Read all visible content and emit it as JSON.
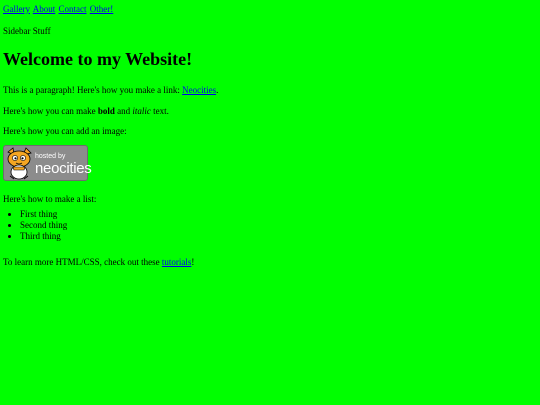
{
  "nav": {
    "links": [
      "Gallery",
      "About",
      "Contact",
      "Other!"
    ]
  },
  "sidebar": {
    "text": "Sidebar Stuff"
  },
  "main": {
    "heading": "Welcome to my Website!",
    "para_link_prefix": "This is a paragraph! Here's how you make a link: ",
    "para_link_text": "Neocities",
    "para_link_suffix": ".",
    "para_bold_prefix": "Here's how you can make ",
    "para_bold_word": "bold",
    "para_bold_middle": " and ",
    "para_italic_word": "italic",
    "para_bold_suffix": " text.",
    "para_image": "Here's how you can add an image:",
    "image_badge": {
      "small_text": "hosted by",
      "big_text": "neocities"
    },
    "para_list": "Here's how to make a list:",
    "list_items": [
      "First thing",
      "Second thing",
      "Third thing"
    ],
    "para_learn_prefix": "To learn more HTML/CSS, check out these ",
    "para_learn_link": "tutorials",
    "para_learn_suffix": "!"
  },
  "colors": {
    "background": "#00ff00",
    "link": "#0000ee",
    "text": "#000000"
  }
}
